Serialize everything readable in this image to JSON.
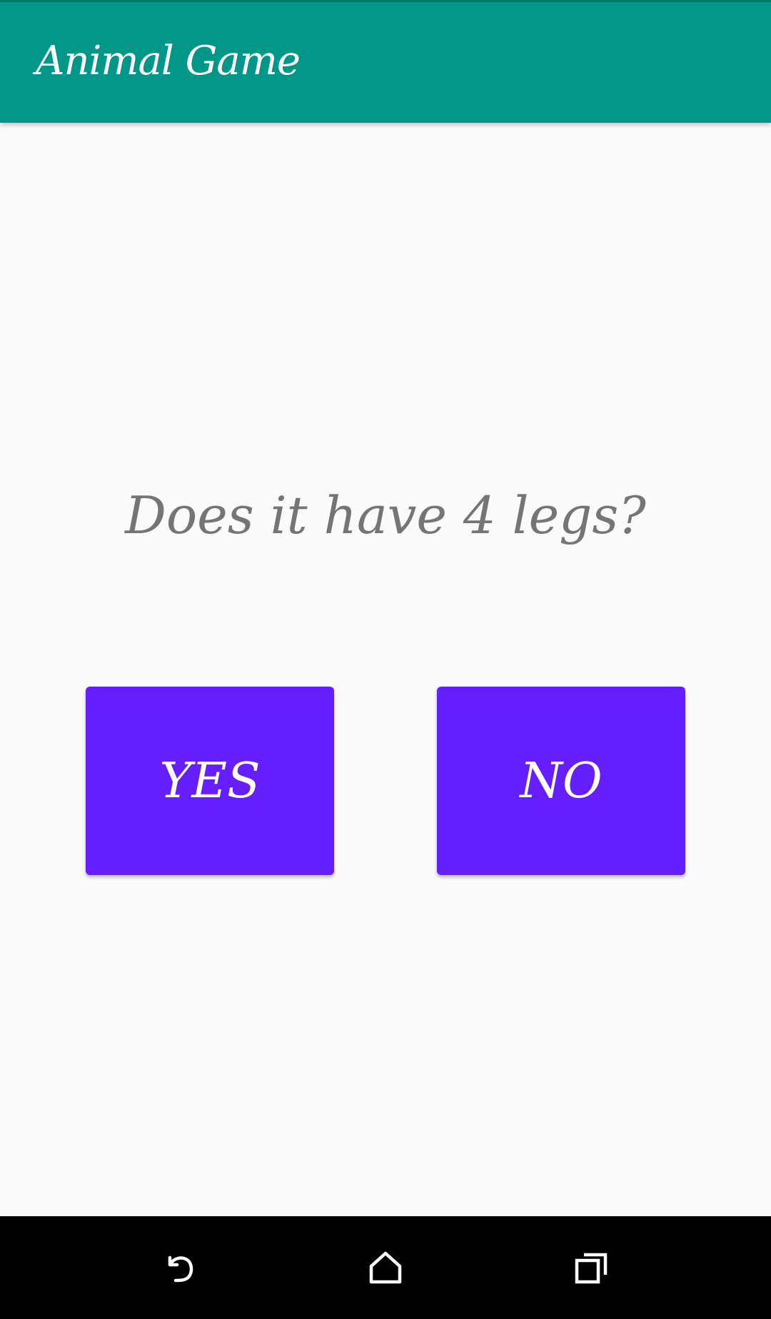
{
  "app_bar": {
    "title": "Animal Game",
    "color": "#009688"
  },
  "main": {
    "question": "Does it have 4 legs?",
    "yes_label": "YES",
    "no_label": "NO",
    "button_color": "#651FFF",
    "question_color": "#757575"
  },
  "nav_bar": {
    "icons": [
      "back-icon",
      "home-icon",
      "recents-icon"
    ]
  }
}
